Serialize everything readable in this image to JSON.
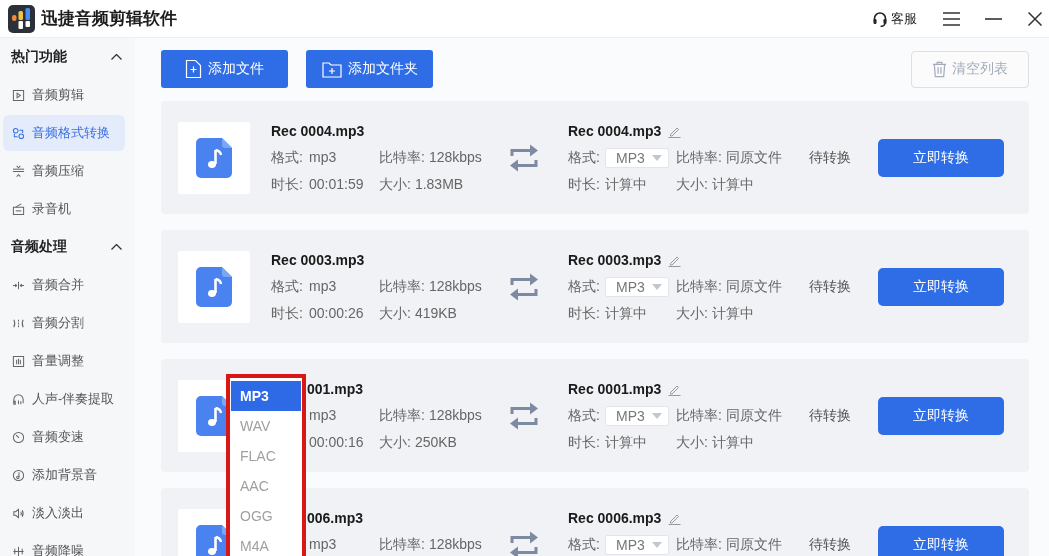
{
  "window": {
    "title": "迅捷音频剪辑软件",
    "support": "客服"
  },
  "sidebar": {
    "groups": [
      {
        "title": "热门功能",
        "expanded": true,
        "items": [
          {
            "label": "音频剪辑",
            "selected": false
          },
          {
            "label": "音频格式转换",
            "selected": true
          },
          {
            "label": "音频压缩",
            "selected": false
          },
          {
            "label": "录音机",
            "selected": false
          }
        ]
      },
      {
        "title": "音频处理",
        "expanded": true,
        "items": [
          {
            "label": "音频合并",
            "selected": false
          },
          {
            "label": "音频分割",
            "selected": false
          },
          {
            "label": "音量调整",
            "selected": false
          },
          {
            "label": "人声-伴奏提取",
            "selected": false
          },
          {
            "label": "音频变速",
            "selected": false
          },
          {
            "label": "添加背景音",
            "selected": false
          },
          {
            "label": "淡入淡出",
            "selected": false
          },
          {
            "label": "音频降噪",
            "selected": false
          }
        ]
      }
    ]
  },
  "toolbar": {
    "add_file": "添加文件",
    "add_folder": "添加文件夹",
    "clear_list": {
      "label": "清空列表",
      "disabled": true
    }
  },
  "files": [
    {
      "source": {
        "name": "Rec 0004.mp3",
        "format_label": "格式:",
        "format": "mp3",
        "bitrate_label": "比特率:",
        "bitrate": "128kbps",
        "duration_label": "时长:",
        "duration": "00:01:59",
        "size_label": "大小:",
        "size": "1.83MB"
      },
      "target": {
        "name": "Rec 0004.mp3",
        "format_label": "格式:",
        "format": "MP3",
        "bitrate_label": "比特率:",
        "bitrate": "同原文件",
        "duration_label": "时长:",
        "duration": "计算中",
        "size_label": "大小:",
        "size": "计算中"
      },
      "status": "待转换",
      "action": "立即转换"
    },
    {
      "source": {
        "name": "Rec 0003.mp3",
        "format_label": "格式:",
        "format": "mp3",
        "bitrate_label": "比特率:",
        "bitrate": "128kbps",
        "duration_label": "时长:",
        "duration": "00:00:26",
        "size_label": "大小:",
        "size": "419KB"
      },
      "target": {
        "name": "Rec 0003.mp3",
        "format_label": "格式:",
        "format": "MP3",
        "bitrate_label": "比特率:",
        "bitrate": "同原文件",
        "duration_label": "时长:",
        "duration": "计算中",
        "size_label": "大小:",
        "size": "计算中"
      },
      "status": "待转换",
      "action": "立即转换"
    },
    {
      "source": {
        "name": "001.mp3",
        "format": "mp3",
        "bitrate_label": "比特率:",
        "bitrate": "128kbps",
        "duration": "00:00:16",
        "size_label": "大小:",
        "size": "250KB"
      },
      "target": {
        "name": "Rec 0001.mp3",
        "format_label": "格式:",
        "format": "MP3",
        "bitrate_label": "比特率:",
        "bitrate": "同原文件",
        "duration_label": "时长:",
        "duration": "计算中",
        "size_label": "大小:",
        "size": "计算中"
      },
      "status": "待转换",
      "action": "立即转换",
      "format_menu": {
        "options": [
          {
            "label": "MP3",
            "selected": true
          },
          {
            "label": "WAV",
            "selected": false
          },
          {
            "label": "FLAC",
            "selected": false
          },
          {
            "label": "AAC",
            "selected": false
          },
          {
            "label": "OGG",
            "selected": false
          },
          {
            "label": "M4A",
            "selected": false
          }
        ]
      }
    },
    {
      "source": {
        "name": "006.mp3",
        "format": "mp3",
        "bitrate_label": "比特率:",
        "bitrate": "128kbps"
      },
      "target": {
        "name": "Rec 0006.mp3",
        "format_label": "格式:",
        "format": "MP3",
        "bitrate_label": "比特率:",
        "bitrate": "同原文件"
      },
      "status": "待转换",
      "action": "立即转换"
    }
  ]
}
